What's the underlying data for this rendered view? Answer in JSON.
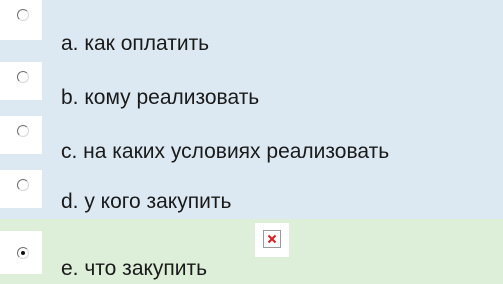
{
  "question": {
    "options": [
      {
        "label": "a. как оплатить",
        "checked": false
      },
      {
        "label": "b. кому реализовать",
        "checked": false
      },
      {
        "label": "c. на каких условиях реализовать",
        "checked": false
      },
      {
        "label": "d. у кого закупить",
        "checked": false
      },
      {
        "label": "e. что закупить",
        "checked": true
      }
    ],
    "selected_icon": "broken-image-icon",
    "colors": {
      "option_bg": "#dce9f2",
      "selected_bg": "#deefd9"
    }
  }
}
